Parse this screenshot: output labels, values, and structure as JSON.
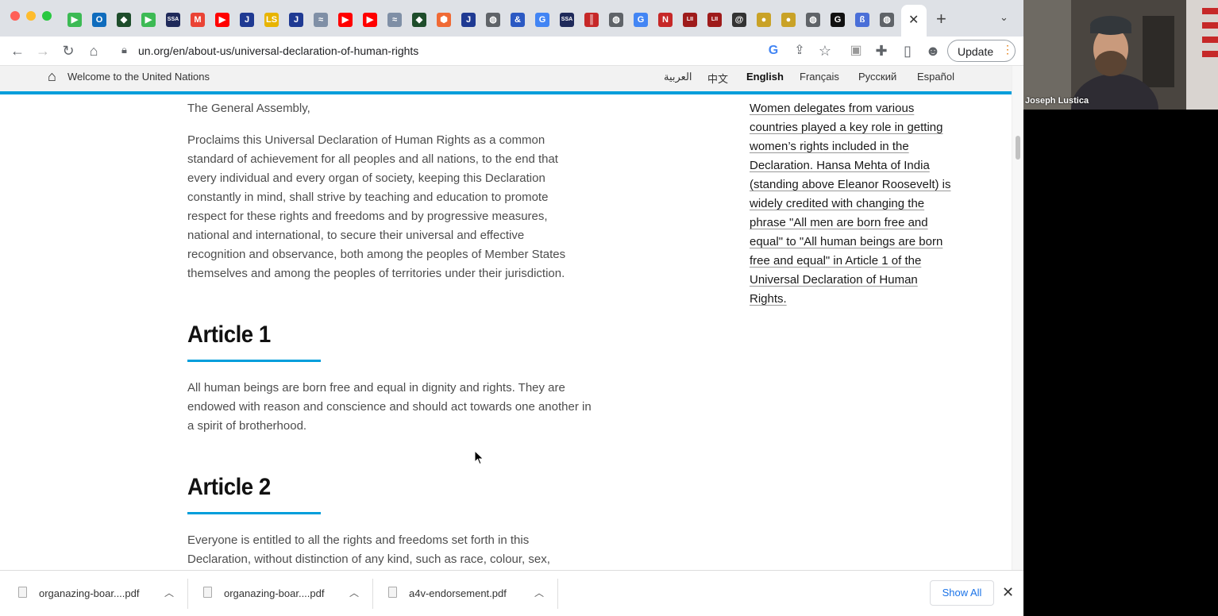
{
  "browser": {
    "url": "un.org/en/about-us/universal-declaration-of-human-rights",
    "update_label": "Update",
    "tab_favicons": [
      {
        "icon": "play-icon",
        "color": "#3cba54",
        "text": "▶"
      },
      {
        "icon": "outlook-icon",
        "color": "#0f6cbd",
        "text": "O"
      },
      {
        "icon": "shield-icon",
        "color": "#1e4d2b",
        "text": "◆"
      },
      {
        "icon": "play-icon",
        "color": "#3cba54",
        "text": "▶"
      },
      {
        "icon": "ssa-icon",
        "color": "#1f2a5a",
        "text": "SSA"
      },
      {
        "icon": "gmail-icon",
        "color": "#ea4335",
        "text": "M"
      },
      {
        "icon": "youtube-icon",
        "color": "#ff0000",
        "text": "▶"
      },
      {
        "icon": "j-icon",
        "color": "#1f3a93",
        "text": "J"
      },
      {
        "icon": "ls-icon",
        "color": "#e8b400",
        "text": "LS"
      },
      {
        "icon": "j-icon",
        "color": "#1f3a93",
        "text": "J"
      },
      {
        "icon": "wave-icon",
        "color": "#7f8fa6",
        "text": "≈"
      },
      {
        "icon": "youtube-icon",
        "color": "#ff0000",
        "text": "▶"
      },
      {
        "icon": "youtube-icon",
        "color": "#ff0000",
        "text": "▶"
      },
      {
        "icon": "wave-icon",
        "color": "#7f8fa6",
        "text": "≈"
      },
      {
        "icon": "shield-icon",
        "color": "#1e4d2b",
        "text": "◆"
      },
      {
        "icon": "hex-icon",
        "color": "#f06a35",
        "text": "⬢"
      },
      {
        "icon": "j-icon",
        "color": "#1f3a93",
        "text": "J"
      },
      {
        "icon": "globe-icon",
        "color": "#5f6368",
        "text": "◍"
      },
      {
        "icon": "ampersand-icon",
        "color": "#2b59c3",
        "text": "&"
      },
      {
        "icon": "google-icon",
        "color": "#4285f4",
        "text": "G"
      },
      {
        "icon": "ssa-icon",
        "color": "#1f2a5a",
        "text": "SSA"
      },
      {
        "icon": "bars-icon",
        "color": "#c62828",
        "text": "║"
      },
      {
        "icon": "globe-icon",
        "color": "#5f6368",
        "text": "◍"
      },
      {
        "icon": "google-icon",
        "color": "#4285f4",
        "text": "G"
      },
      {
        "icon": "nyt-icon",
        "color": "#c62828",
        "text": "N"
      },
      {
        "icon": "lii-icon",
        "color": "#9e1b1b",
        "text": "LII"
      },
      {
        "icon": "lii-icon",
        "color": "#9e1b1b",
        "text": "LII"
      },
      {
        "icon": "spiral-icon",
        "color": "#333333",
        "text": "@"
      },
      {
        "icon": "coin-icon",
        "color": "#c9a227",
        "text": "●"
      },
      {
        "icon": "coin-icon",
        "color": "#c9a227",
        "text": "●"
      },
      {
        "icon": "globe-icon",
        "color": "#5f6368",
        "text": "◍"
      },
      {
        "icon": "g-icon",
        "color": "#111111",
        "text": "G"
      },
      {
        "icon": "bookmark-icon",
        "color": "#4a6fd8",
        "text": "ß"
      },
      {
        "icon": "globe-icon",
        "color": "#5f6368",
        "text": "◍"
      }
    ]
  },
  "un_header": {
    "welcome": "Welcome to the United Nations",
    "languages": [
      "العربية",
      "中文",
      "English",
      "Français",
      "Русский",
      "Español"
    ],
    "active_language": "English"
  },
  "content": {
    "general_assembly": "The General Assembly,",
    "proclamation": "Proclaims this Universal Declaration of Human Rights as a common standard of achievement for all peoples and all nations, to the end that every individual and every organ of society, keeping this Declaration constantly in mind, shall strive by teaching and education to promote respect for these rights and freedoms and by progressive measures, national and international, to secure their universal and effective recognition and observance, both among the peoples of Member States themselves and among the peoples of territories under their jurisdiction.",
    "article1_title": "Article 1",
    "article1_text": "All human beings are born free and equal in dignity and rights. They are endowed with reason and conscience and should act towards one another in a spirit of brotherhood.",
    "article2_title": "Article 2",
    "article2_text": "Everyone is entitled to all the rights and freedoms set forth in this Declaration, without distinction of any kind, such as race, colour, sex,",
    "sidebar_caption": "Women delegates from various countries played a key role in getting women’s rights included in the Declaration. Hansa Mehta of India (standing above Eleanor Roosevelt) is widely credited with changing the phrase \"All men are born free and equal\" to \"All human beings are born free and equal\" in Article 1 of the Universal Declaration of Human Rights."
  },
  "downloads": {
    "items": [
      "organazing-boar....pdf",
      "organazing-boar....pdf",
      "a4v-endorsement.pdf"
    ],
    "show_all": "Show All"
  },
  "video": {
    "participant_name": "Joseph Lustica"
  },
  "colors": {
    "un_blue": "#009edb",
    "link_blue": "#1a73e8"
  }
}
